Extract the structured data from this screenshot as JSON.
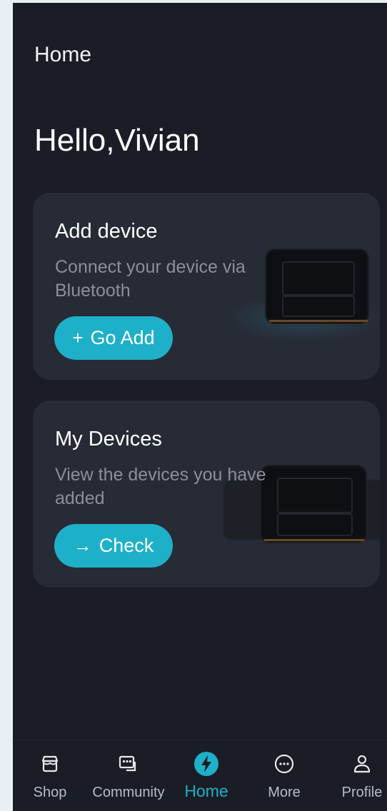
{
  "header": {
    "title": "Home"
  },
  "greeting": "Hello,Vivian",
  "cards": [
    {
      "title": "Add device",
      "description": "Connect your device via Bluetooth",
      "button_icon": "plus-icon",
      "button_label": "Go Add"
    },
    {
      "title": "My Devices",
      "description": "View the devices you have added",
      "button_icon": "arrow-right-icon",
      "button_label": "Check"
    }
  ],
  "nav": {
    "items": [
      {
        "label": "Shop",
        "icon": "shop-icon"
      },
      {
        "label": "Community",
        "icon": "community-chat-icon"
      },
      {
        "label": "Home",
        "icon": "lightning-bolt-icon",
        "active": true
      },
      {
        "label": "More",
        "icon": "more-dots-icon"
      },
      {
        "label": "Profile",
        "icon": "profile-icon"
      }
    ]
  },
  "colors": {
    "background": "#1a1d25",
    "card": "#272b35",
    "accent": "#1eb0c8",
    "muted_text": "#8a8f99"
  }
}
